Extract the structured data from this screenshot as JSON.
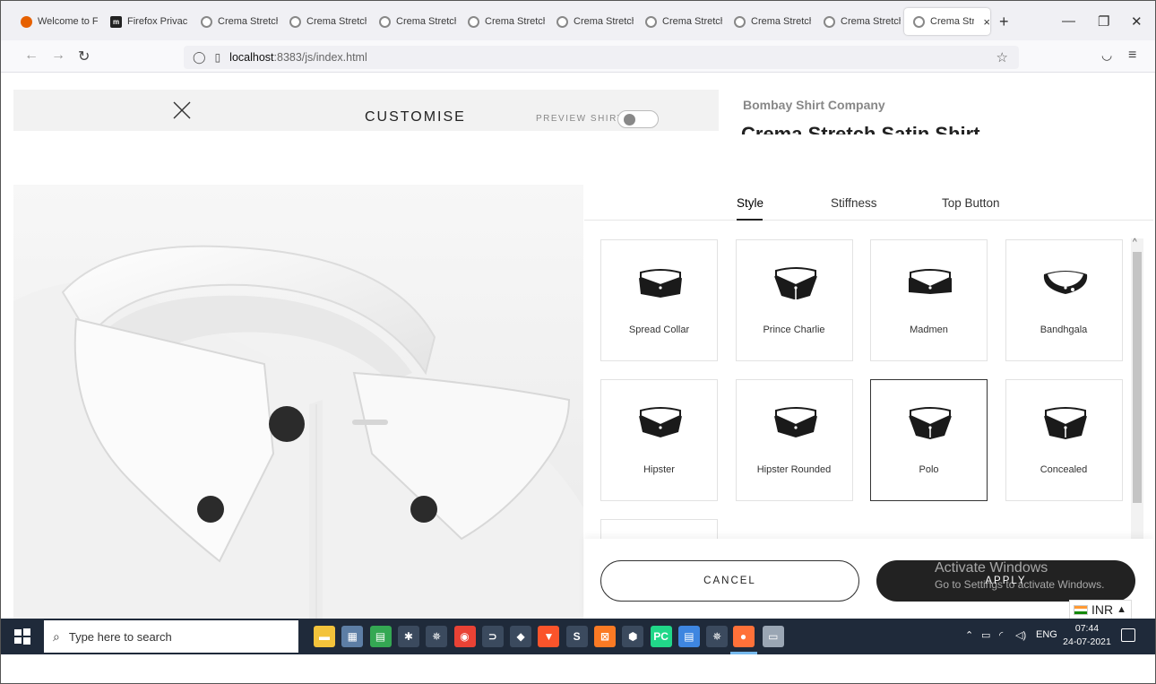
{
  "browser": {
    "tabs": [
      {
        "title": "Welcome to Fi",
        "favicon": "firefox-icon",
        "color": "#e66000"
      },
      {
        "title": "Firefox Privacy",
        "favicon": "m-icon",
        "color": "#222222"
      },
      {
        "title": "Crema Stretch",
        "favicon": "globe-icon",
        "color": "#888888"
      },
      {
        "title": "Crema Stretch",
        "favicon": "globe-icon",
        "color": "#888888"
      },
      {
        "title": "Crema Stretch",
        "favicon": "globe-icon",
        "color": "#888888"
      },
      {
        "title": "Crema Stretch",
        "favicon": "globe-icon",
        "color": "#888888"
      },
      {
        "title": "Crema Stretch",
        "favicon": "globe-icon",
        "color": "#888888"
      },
      {
        "title": "Crema Stretch",
        "favicon": "globe-icon",
        "color": "#888888"
      },
      {
        "title": "Crema Stretch",
        "favicon": "globe-icon",
        "color": "#888888"
      },
      {
        "title": "Crema Stretch",
        "favicon": "globe-icon",
        "color": "#888888"
      },
      {
        "title": "Crema Stret",
        "favicon": "globe-icon",
        "color": "#888888",
        "active": true
      }
    ],
    "url_host": "localhost",
    "url_path": ":8383/js/index.html"
  },
  "page": {
    "header": {
      "customise": "CUSTOMISE",
      "preview_label": "PREVIEW SHIRT"
    },
    "brand": "Bombay Shirt Company",
    "product_title": "Crema Stretch Satin Shirt"
  },
  "panel": {
    "tabs": [
      "Style",
      "Stiffness",
      "Top Button"
    ],
    "selected_tab": "Style",
    "collars": [
      {
        "label": "Spread Collar",
        "shape": "spread"
      },
      {
        "label": "Prince Charlie",
        "shape": "prince"
      },
      {
        "label": "Madmen",
        "shape": "madmen"
      },
      {
        "label": "Bandhgala",
        "shape": "band"
      },
      {
        "label": "Hipster",
        "shape": "hipster"
      },
      {
        "label": "Hipster Rounded",
        "shape": "hipster"
      },
      {
        "label": "Polo",
        "shape": "polo",
        "selected": true
      },
      {
        "label": "Concealed",
        "shape": "concealed"
      }
    ],
    "cancel_label": "CANCEL",
    "apply_label": "APPLY"
  },
  "overlay": {
    "activate_title": "Activate Windows",
    "activate_sub": "Go to Settings to activate Windows."
  },
  "currency": "INR",
  "taskbar": {
    "search_placeholder": "Type here to search",
    "lang": "ENG",
    "time": "07:44",
    "date": "24-07-2021",
    "apps": [
      {
        "name": "file-explorer-icon",
        "color": "#f3c33b"
      },
      {
        "name": "calculator-icon",
        "color": "#5d7ea5"
      },
      {
        "name": "sheets-icon",
        "color": "#34a853"
      },
      {
        "name": "spider-icon",
        "color": "#3b4a5e"
      },
      {
        "name": "spider-web-icon",
        "color": "#3b4a5e"
      },
      {
        "name": "chrome-icon",
        "color": "#e94235"
      },
      {
        "name": "vscode-like-icon",
        "color": "#3b4a5e"
      },
      {
        "name": "git-icon",
        "color": "#3b4a5e"
      },
      {
        "name": "brave-icon",
        "color": "#fb542b"
      },
      {
        "name": "sublime-icon",
        "color": "#3b4a5e"
      },
      {
        "name": "xampp-icon",
        "color": "#fb7a24"
      },
      {
        "name": "virtualbox-icon",
        "color": "#3b4a5e"
      },
      {
        "name": "pycharm-icon",
        "color": "#21d789"
      },
      {
        "name": "notepad-icon",
        "color": "#3e86e0"
      },
      {
        "name": "spider-app-icon",
        "color": "#3b4a5e"
      },
      {
        "name": "firefox-icon",
        "color": "#ff7139"
      },
      {
        "name": "photos-icon",
        "color": "#9aa6b4"
      }
    ]
  }
}
